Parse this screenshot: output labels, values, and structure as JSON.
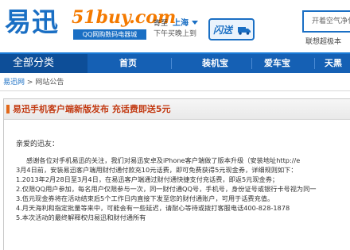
{
  "header": {
    "logo_text": "易迅",
    "logo_51_text": "51buy.com",
    "logo_51_sub": "QQ网购数码电器城",
    "region_label": "寄至",
    "region_city": "上海",
    "order_hint": "下午买晚上到",
    "badge_text": "闪送",
    "search_placeholder": "开着空气净化",
    "search_hot": "联想超极本"
  },
  "nav": {
    "all_categories": "全部分类",
    "items": [
      "首页",
      "装机宝",
      "爱车宝",
      "天黑"
    ]
  },
  "breadcrumb": {
    "home": "易迅网",
    "separator": ">",
    "current": "网站公告"
  },
  "article": {
    "title": "易迅手机客户端新版发布 充话费即送5元",
    "greeting": "亲爱的迅友：",
    "lines": [
      "感谢各位对手机易迅的关注，我们对易迅安卓及iPhone客户端做了版本升级（安装地址http://e",
      "3月4日前，安装易迅客户端用财付通付款充10元话费，即可免费获得5元现金券，详细规则如下：",
      "1.2013年2月28日至3月4日，在易迅客户端通过财付通快捷支付充话费，即返5元现金券；",
      "2.仅限QQ用户参加，每名用户仅限参与一次，同一财付通QQ号，手机号，身份证号或银行卡号视为同一",
      "3.伍元现金券将在活动结束后5个工作日内直接下发至您的财付通账户，可用于话费充值。",
      "4.月天海利和指定批量等来中，可能会有一些延迟，请耐心等待或拨打客服电话400-828-1878",
      "5.本次活动的最终解释权归易迅和财付通所有"
    ]
  },
  "colors": {
    "brand_blue": "#1a6fc4",
    "nav_blue": "#1560b4",
    "accent_orange": "#f47a00",
    "title_red": "#c23a12"
  }
}
